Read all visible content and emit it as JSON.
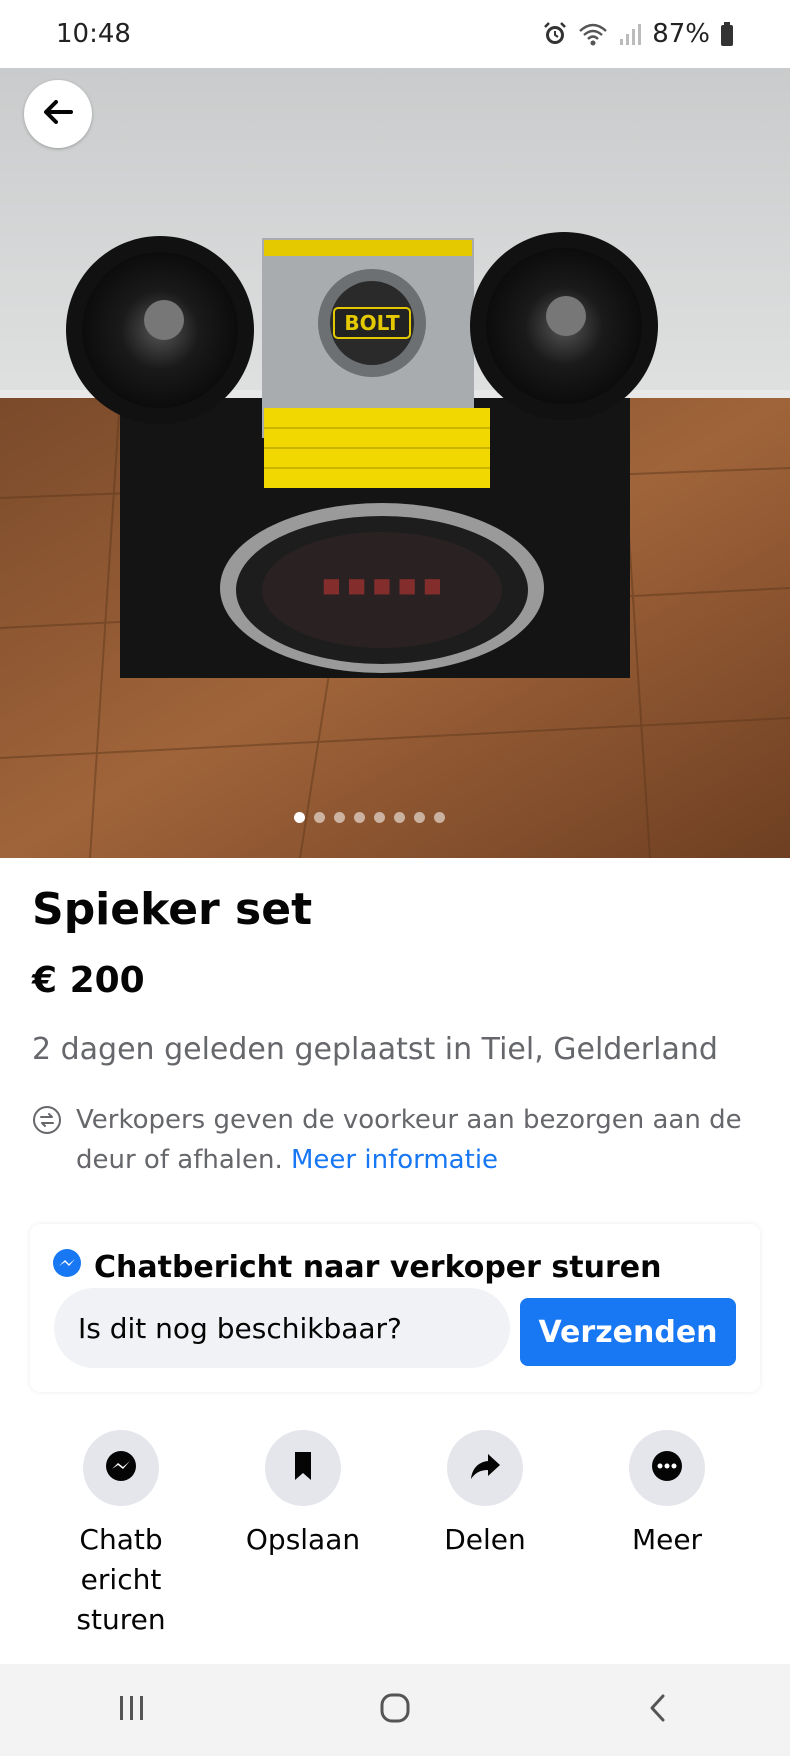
{
  "status_bar": {
    "time": "10:48",
    "battery": "87%",
    "icons": [
      "alarm-icon",
      "wifi-icon",
      "signal-icon",
      "battery-icon"
    ]
  },
  "photo": {
    "image_count": 8,
    "active_index": 0,
    "description_icons": [
      "back-arrow-icon"
    ],
    "logo_text": "BOLT"
  },
  "listing": {
    "title": "Spieker set",
    "price": "€ 200",
    "posted": "2 dagen geleden geplaatst in Tiel, Gelderland",
    "delivery_text": "Verkopers geven de voorkeur aan bezorgen aan de deur of afhalen.",
    "more_info": "Meer informatie"
  },
  "chat": {
    "heading": "Chatbericht naar verkoper sturen",
    "input_value": "Is dit nog beschikbaar?",
    "send_label": "Verzenden"
  },
  "actions": [
    {
      "label": "Chatb ericht sturen",
      "icon": "messenger-icon"
    },
    {
      "label": "Opslaan",
      "icon": "bookmark-icon"
    },
    {
      "label": "Delen",
      "icon": "share-icon"
    },
    {
      "label": "Meer",
      "icon": "more-icon"
    }
  ],
  "nav": [
    "recent-apps-icon",
    "home-icon",
    "back-icon"
  ],
  "colors": {
    "accent": "#1877f2",
    "secondary_text": "#65676b",
    "input_bg": "#f0f2f5",
    "icon_circle": "#e4e6eb"
  }
}
